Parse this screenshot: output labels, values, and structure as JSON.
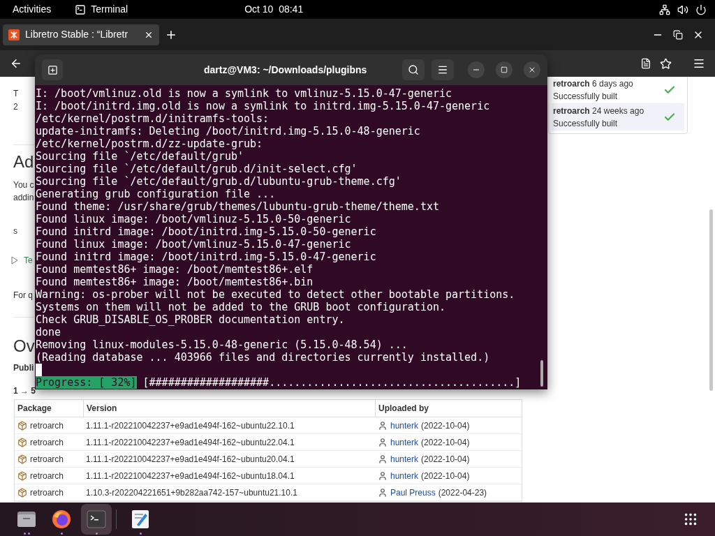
{
  "top_bar": {
    "activities": "Activities",
    "app": "Terminal",
    "clock": "Oct 10  08:41"
  },
  "browser": {
    "tabs": [
      {
        "title": "Libretro Stable : “Libretr",
        "selected": true
      }
    ]
  },
  "page": {
    "sections": [
      {
        "fragments": [
          {
            "text": "T",
            "kind": "text"
          },
          {
            "text": "2",
            "kind": "text"
          }
        ]
      },
      {
        "fragments": [
          {
            "text": "Ad",
            "kind": "heading"
          },
          {
            "text": "You c",
            "kind": "text"
          },
          {
            "text": "addin",
            "kind": "text"
          },
          {
            "text": "s",
            "kind": "text"
          },
          {
            "text": "Te",
            "kind": "toggle"
          },
          {
            "text": "For q",
            "kind": "text"
          }
        ]
      },
      {
        "fragments": [
          {
            "text": "Ov",
            "kind": "heading"
          },
          {
            "text": "Publi",
            "kind": "bold"
          },
          {
            "text": "1 → 5",
            "kind": "count"
          }
        ]
      }
    ],
    "builds": [
      {
        "name": "retroarch",
        "age": "6 days ago",
        "status": "Successfully built",
        "highlighted": false
      },
      {
        "name": "retroarch",
        "age": "24 weeks ago",
        "status": "Successfully built",
        "highlighted": true
      }
    ],
    "table": {
      "columns": [
        "Package",
        "Version",
        "Uploaded by"
      ],
      "rows": [
        {
          "package": "retroarch",
          "version": "1.11.1-r202210042237+e9ad1e494f-162~ubuntu22.10.1",
          "uploader": "hunterk",
          "date": "(2022-10-04)"
        },
        {
          "package": "retroarch",
          "version": "1.11.1-r202210042237+e9ad1e494f-162~ubuntu22.04.1",
          "uploader": "hunterk",
          "date": "(2022-10-04)"
        },
        {
          "package": "retroarch",
          "version": "1.11.1-r202210042237+e9ad1e494f-162~ubuntu20.04.1",
          "uploader": "hunterk",
          "date": "(2022-10-04)"
        },
        {
          "package": "retroarch",
          "version": "1.11.1-r202210042237+e9ad1e494f-162~ubuntu18.04.1",
          "uploader": "hunterk",
          "date": "(2022-10-04)"
        },
        {
          "package": "retroarch",
          "version": "1.10.3-r202204221651+9b282aa742-157~ubuntu21.10.1",
          "uploader": "Paul Preuss",
          "date": "(2022-04-23)"
        }
      ]
    }
  },
  "terminal": {
    "title": "dartz@VM3: ~/Downloads/plugibns",
    "lines": [
      "I: /boot/vmlinuz.old is now a symlink to vmlinuz-5.15.0-47-generic",
      "I: /boot/initrd.img.old is now a symlink to initrd.img-5.15.0-47-generic",
      "/etc/kernel/postrm.d/initramfs-tools:",
      "update-initramfs: Deleting /boot/initrd.img-5.15.0-48-generic",
      "/etc/kernel/postrm.d/zz-update-grub:",
      "Sourcing file `/etc/default/grub'",
      "Sourcing file `/etc/default/grub.d/init-select.cfg'",
      "Sourcing file `/etc/default/grub.d/lubuntu-grub-theme.cfg'",
      "Generating grub configuration file ...",
      "Found theme: /usr/share/grub/themes/lubuntu-grub-theme/theme.txt",
      "Found linux image: /boot/vmlinuz-5.15.0-50-generic",
      "Found initrd image: /boot/initrd.img-5.15.0-50-generic",
      "Found linux image: /boot/vmlinuz-5.15.0-47-generic",
      "Found initrd image: /boot/initrd.img-5.15.0-47-generic",
      "Found memtest86+ image: /boot/memtest86+.elf",
      "Found memtest86+ image: /boot/memtest86+.bin",
      "Warning: os-prober will not be executed to detect other bootable partitions.",
      "Systems on them will not be added to the GRUB boot configuration.",
      "Check GRUB_DISABLE_OS_PROBER documentation entry.",
      "done",
      "Removing linux-modules-5.15.0-48-generic (5.15.0-48.54) ...",
      "(Reading database ... 403966 files and directories currently installed.)"
    ],
    "progress": {
      "label": "Progress: [ 32%]",
      "bar": "[###################.......................................]"
    }
  },
  "dock": [
    {
      "kind": "files",
      "running": true,
      "multiple": true,
      "active": false
    },
    {
      "kind": "firefox",
      "running": true,
      "multiple": false,
      "active": false
    },
    {
      "kind": "terminal",
      "running": true,
      "multiple": false,
      "active": true
    },
    {
      "kind": "editor",
      "running": true,
      "multiple": false,
      "active": false
    }
  ]
}
